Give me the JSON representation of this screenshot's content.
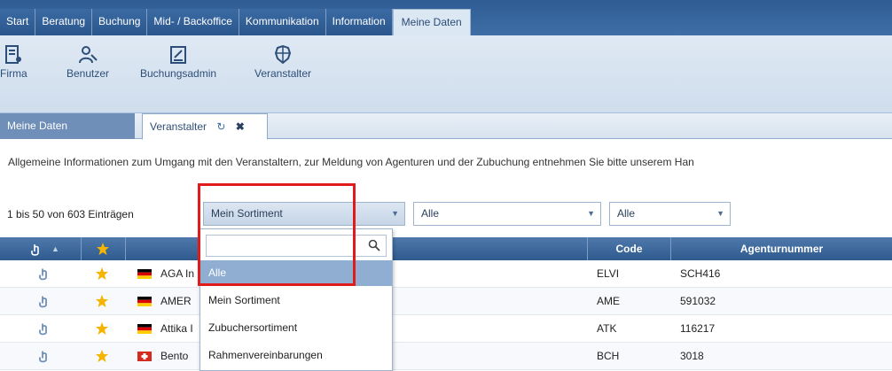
{
  "menu": {
    "tabs": [
      "Start",
      "Beratung",
      "Buchung",
      "Mid- / Backoffice",
      "Kommunikation",
      "Information",
      "Meine Daten"
    ]
  },
  "ribbon": {
    "buttons": [
      {
        "label": "Firma",
        "icon": "company-icon"
      },
      {
        "label": "Benutzer",
        "icon": "users-icon"
      },
      {
        "label": "Buchungsadmin",
        "icon": "booking-admin-icon"
      },
      {
        "label": "Veranstalter",
        "icon": "tour-operator-icon"
      }
    ]
  },
  "section": {
    "primary_label": "Meine Daten",
    "doc_tab_label": "Veranstalter",
    "refresh_icon": "↻",
    "close_icon": "✖"
  },
  "info_text": "Allgemeine Informationen zum Umgang mit den Veranstaltern, zur Meldung von Agenturen und der Zubuchung entnehmen Sie bitte unserem Han",
  "filters": {
    "count_text": "1 bis 50 von 603 Einträgen",
    "sortiment_value": "Mein Sortiment",
    "filter2_value": "Alle",
    "filter3_value": "Alle"
  },
  "table": {
    "headers": {
      "code": "Code",
      "agentur": "Agenturnummer"
    },
    "rows": [
      {
        "name": "AGA In",
        "code": "ELVI",
        "agentur": "SCH416",
        "flag": "de"
      },
      {
        "name": "AMER",
        "code": "AME",
        "agentur": "591032",
        "flag": "de"
      },
      {
        "name": "Attika I",
        "code": "ATK",
        "agentur": "116217",
        "flag": "de"
      },
      {
        "name": "Bento",
        "code": "BCH",
        "agentur": "3018",
        "flag": "ch"
      }
    ]
  },
  "dropdown": {
    "search_placeholder": "",
    "options": [
      "Alle",
      "Mein Sortiment",
      "Zubuchersortiment",
      "Rahmenvereinbarungen"
    ],
    "selected_index": 0
  },
  "colors": {
    "accent": "#2f5a8e",
    "selection": "#8faed2",
    "highlight_box": "#e11a1a",
    "favorite_star": "#f5b400"
  }
}
